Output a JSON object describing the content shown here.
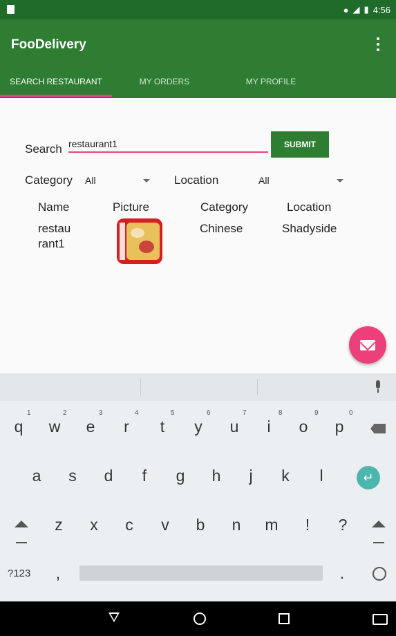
{
  "status_bar": {
    "time": "4:56"
  },
  "app": {
    "title": "FooDelivery"
  },
  "tabs": [
    {
      "label": "SEARCH RESTAURANT",
      "active": true
    },
    {
      "label": "MY ORDERS",
      "active": false
    },
    {
      "label": "MY PROFILE",
      "active": false
    }
  ],
  "search": {
    "label": "Search",
    "value": "restaurant1",
    "submit_label": "SUBMIT"
  },
  "filters": {
    "category_label": "Category",
    "category_value": "All",
    "location_label": "Location",
    "location_value": "All"
  },
  "table": {
    "headers": [
      "Name",
      "Picture",
      "Category",
      "Location"
    ],
    "rows": [
      {
        "name_line1": "restau",
        "name_line2": "rant1",
        "category": "Chinese",
        "location": "Shadyside"
      }
    ]
  },
  "keyboard": {
    "row1": [
      "q",
      "w",
      "e",
      "r",
      "t",
      "y",
      "u",
      "i",
      "o",
      "p"
    ],
    "row1_hints": [
      "1",
      "2",
      "3",
      "4",
      "5",
      "6",
      "7",
      "8",
      "9",
      "0"
    ],
    "row2": [
      "a",
      "s",
      "d",
      "f",
      "g",
      "h",
      "j",
      "k",
      "l"
    ],
    "row3": [
      "z",
      "x",
      "c",
      "v",
      "b",
      "n",
      "m",
      "!",
      "?"
    ],
    "sym_label": "?123",
    "comma": ",",
    "period": "."
  },
  "colors": {
    "primary": "#2e7d32",
    "accent": "#ec407a"
  }
}
